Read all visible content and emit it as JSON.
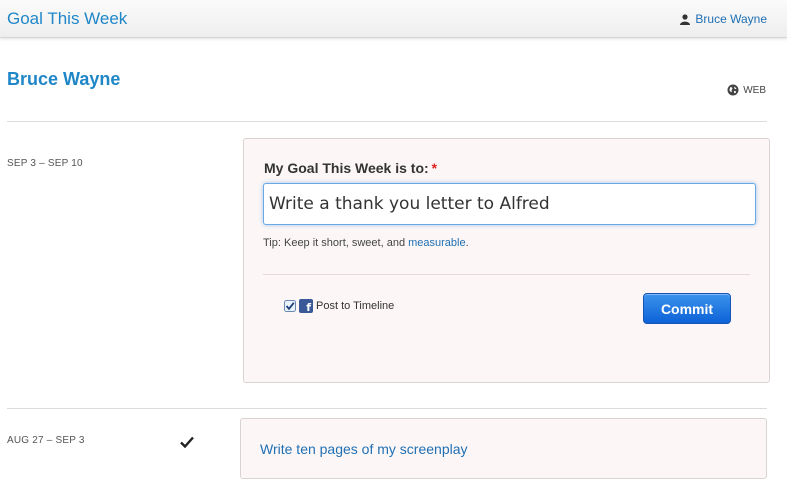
{
  "header": {
    "app_title": "Goal This Week",
    "user_name": "Bruce Wayne"
  },
  "profile": {
    "name": "Bruce Wayne",
    "visibility": "WEB"
  },
  "current_week": {
    "range": "SEP 3 – SEP 10",
    "form": {
      "heading": "My Goal This Week is to:",
      "required_mark": "*",
      "goal_value": "Write a thank you letter to Alfred",
      "tip_label": "Tip",
      "tip_text": ": Keep it short, sweet, and ",
      "tip_link": "measurable",
      "tip_end": ".",
      "post_to_timeline_label": "Post to Timeline",
      "post_to_timeline_checked": true,
      "commit_label": "Commit"
    }
  },
  "past_weeks": [
    {
      "range": "AUG 27 – SEP 3",
      "completed": true,
      "goal": "Write ten pages of my screenplay"
    }
  ],
  "colors": {
    "accent": "#1f86c8",
    "link": "#1f6fb3",
    "button": "#0d62d7",
    "card_bg": "#fcf7f6",
    "facebook": "#3b5998"
  },
  "icons": [
    "user-icon",
    "globe-icon",
    "checkbox-icon",
    "facebook-icon",
    "checkmark-icon"
  ]
}
